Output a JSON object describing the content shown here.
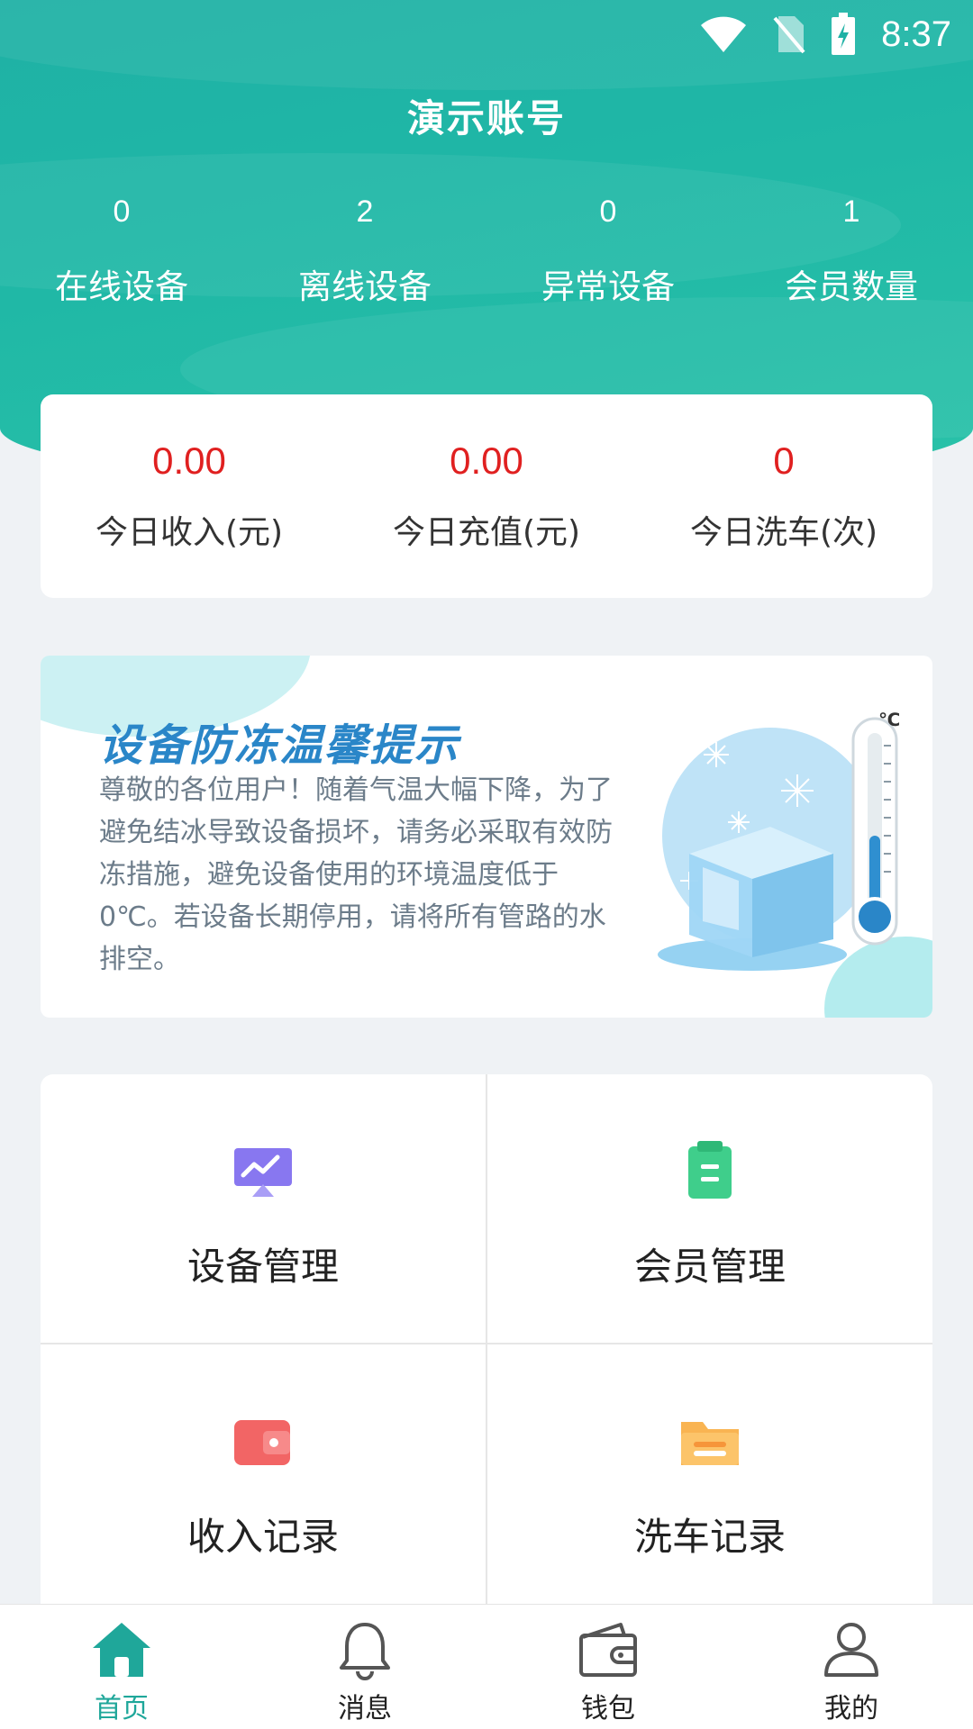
{
  "status_bar": {
    "time": "8:37"
  },
  "header": {
    "title": "演示账号"
  },
  "stats": [
    {
      "value": "0",
      "label": "在线设备"
    },
    {
      "value": "2",
      "label": "离线设备"
    },
    {
      "value": "0",
      "label": "异常设备"
    },
    {
      "value": "1",
      "label": "会员数量"
    }
  ],
  "today": [
    {
      "value": "0.00",
      "label": "今日收入(元)"
    },
    {
      "value": "0.00",
      "label": "今日充值(元)"
    },
    {
      "value": "0",
      "label": "今日洗车(次)"
    }
  ],
  "notice": {
    "title": "设备防冻温馨提示",
    "body": "尊敬的各位用户！随着气温大幅下降，为了避免结冰导致设备损坏，请务必采取有效防冻措施，避免设备使用的环境温度低于0℃。若设备长期停用，请将所有管路的水排空。",
    "thermometer_unit": "℃"
  },
  "menu": [
    {
      "label": "设备管理",
      "icon": "monitor-chart-icon",
      "color": "#8877f0"
    },
    {
      "label": "会员管理",
      "icon": "clipboard-icon",
      "color": "#3fce8b"
    },
    {
      "label": "收入记录",
      "icon": "wallet-icon",
      "color": "#f26565"
    },
    {
      "label": "洗车记录",
      "icon": "folder-icon",
      "color": "#f9b452"
    }
  ],
  "nav": [
    {
      "label": "首页",
      "icon": "home-icon",
      "active": true
    },
    {
      "label": "消息",
      "icon": "bell-icon",
      "active": false
    },
    {
      "label": "钱包",
      "icon": "wallet-icon",
      "active": false
    },
    {
      "label": "我的",
      "icon": "user-icon",
      "active": false
    }
  ],
  "colors": {
    "brand": "#1fb1a5",
    "accent_red": "#e02020",
    "nav_active": "#1fa79a"
  }
}
